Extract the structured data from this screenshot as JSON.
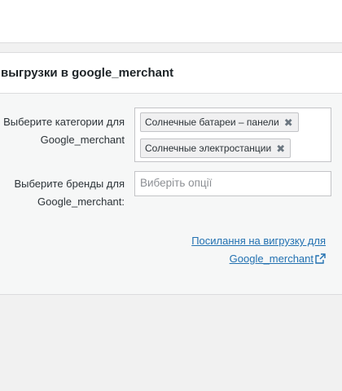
{
  "panel": {
    "title": "выгрузки в google_merchant"
  },
  "categories": {
    "label_line1": "Выберите категории для",
    "label_line2": "Google_merchant",
    "tags": [
      {
        "label": "Солнечные батареи – панели"
      },
      {
        "label": "Солнечные электростанции"
      }
    ],
    "remove_glyph": "✖"
  },
  "brands": {
    "label_line1": "Выберите бренды для",
    "label_line2": "Google_merchant:",
    "placeholder": "Виберіть опції"
  },
  "export_link": {
    "line1": "Посилання на вигрузку для",
    "line2": "Google_merchant",
    "icon": "external-link-icon"
  },
  "colors": {
    "link": "#2271b1",
    "panel_bg": "#f6f7f7",
    "page_bg": "#f1f1f1"
  }
}
